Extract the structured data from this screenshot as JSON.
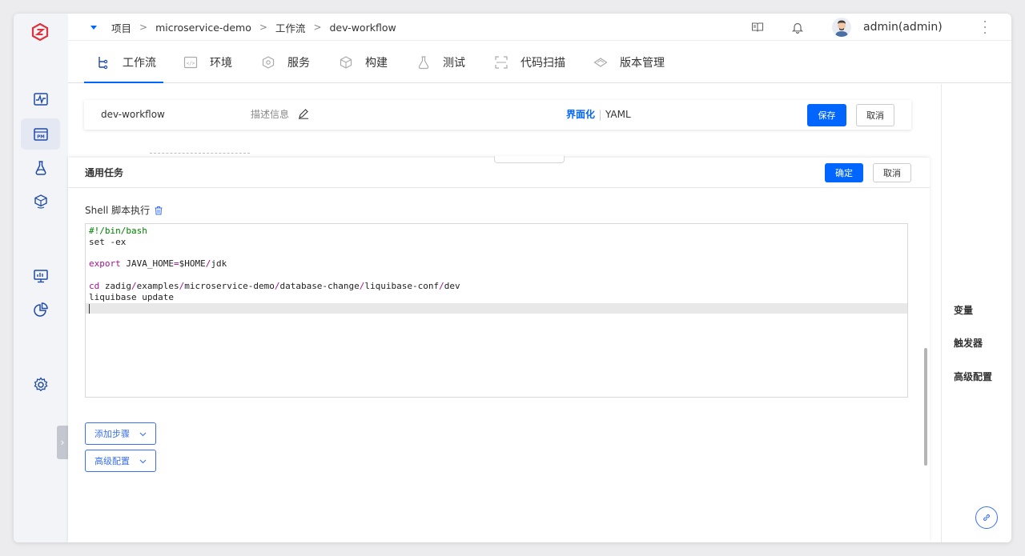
{
  "header": {
    "breadcrumbs": [
      "项目",
      "microservice-demo",
      "工作流",
      "dev-workflow"
    ],
    "separator": ">",
    "user": "admin(admin)"
  },
  "tabs": [
    {
      "label": "工作流",
      "icon": "workflow-icon",
      "active": true
    },
    {
      "label": "环境",
      "icon": "environment-icon"
    },
    {
      "label": "服务",
      "icon": "service-icon"
    },
    {
      "label": "构建",
      "icon": "build-icon"
    },
    {
      "label": "测试",
      "icon": "test-icon"
    },
    {
      "label": "代码扫描",
      "icon": "code-scan-icon"
    },
    {
      "label": "版本管理",
      "icon": "version-icon"
    }
  ],
  "workflow_bar": {
    "name": "dev-workflow",
    "desc_label": "描述信息",
    "mode_visual": "界面化",
    "mode_yaml": "YAML",
    "save": "保存",
    "cancel": "取消"
  },
  "panel": {
    "title": "通用任务",
    "confirm": "确定",
    "cancel": "取消",
    "step_label": "Shell 脚本执行",
    "add_step": "添加步骤",
    "advanced": "高级配置"
  },
  "script": {
    "shebang": "#!/bin/bash",
    "line2": "set -ex",
    "export_kw": "export",
    "export_rest": " JAVA_HOME=$HOME/jdk",
    "cd_kw": "cd",
    "cd_rest": " zadig/examples/microservice-demo/database-change/liquibase-conf/dev",
    "line6": "liquibase update"
  },
  "right_pane": {
    "items": [
      "变量",
      "触发器",
      "高级配置"
    ]
  },
  "colors": {
    "primary": "#0066ff",
    "brand_red": "#e0323c"
  }
}
